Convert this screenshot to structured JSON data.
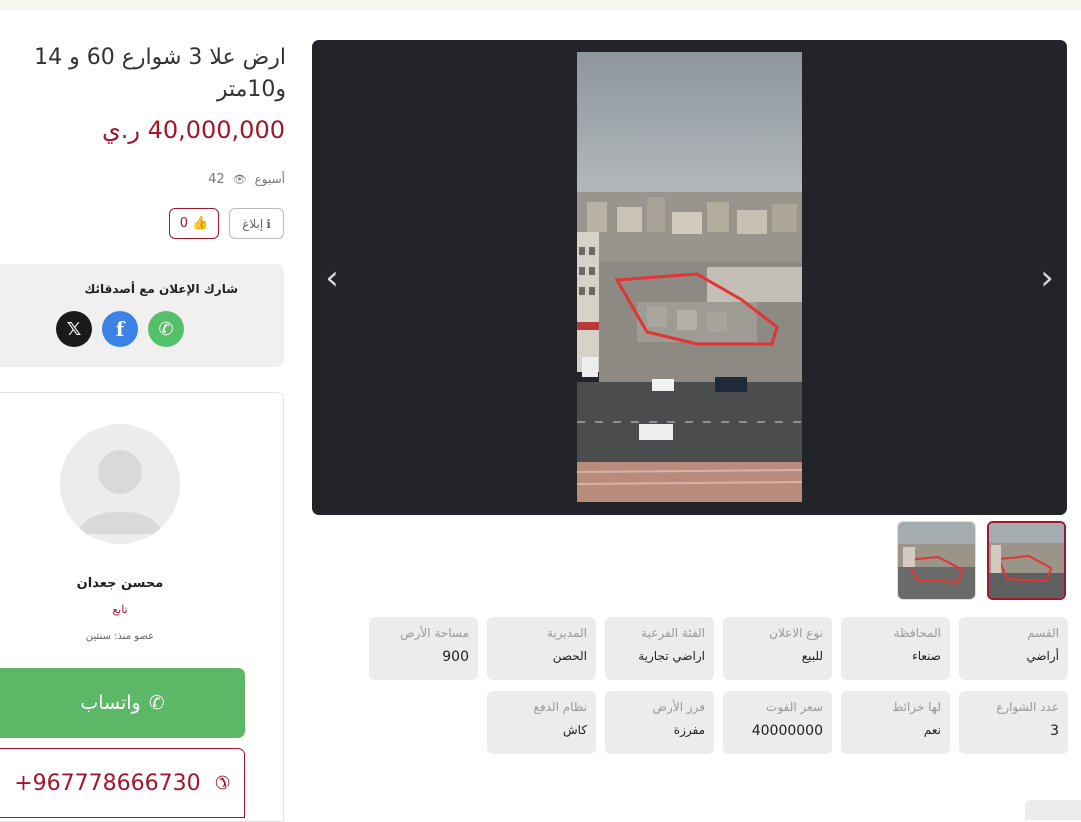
{
  "listing": {
    "title": "ارض علا 3 شوارع 60 و 14 و10متر",
    "price": "40,000,000 ر.ي",
    "views": "42",
    "posted": "أسبوع",
    "report_label": "إبلاغ",
    "likes": "0"
  },
  "share": {
    "title": "شارك الإعلان مع أصدقائك",
    "x_icon": "x-icon",
    "facebook_icon": "facebook-icon",
    "whatsapp_icon": "whatsapp-icon"
  },
  "seller": {
    "name": "محسن جعدان",
    "type": "تابع",
    "member_since": "عضو منذ: سنتين"
  },
  "contact": {
    "whatsapp_label": "واتساب",
    "phone": "+967778666730"
  },
  "gallery": {
    "prev_icon": "chevron-left-icon",
    "next_icon": "chevron-right-icon"
  },
  "attributes_row1": [
    {
      "key": "القسم",
      "value": "أراضي"
    },
    {
      "key": "المحافظة",
      "value": "صنعاء"
    },
    {
      "key": "نوع الاعلان",
      "value": "للبيع"
    },
    {
      "key": "الفئة الفرعية",
      "value": "اراضي تجارية"
    },
    {
      "key": "المديرية",
      "value": "الحصن"
    },
    {
      "key": "مساحة الأرض",
      "value": "900"
    }
  ],
  "attributes_row2": [
    {
      "key": "عدد الشوارع",
      "value": "3"
    },
    {
      "key": "لها خرائط",
      "value": "نعم"
    },
    {
      "key": "سعر الفوت",
      "value": "40000000"
    },
    {
      "key": "فرز الأرض",
      "value": "مفرزة"
    },
    {
      "key": "نظام الدفع",
      "value": "كاش"
    }
  ],
  "colors": {
    "accent": "#a0172b",
    "whatsapp": "#5cb867",
    "facebook": "#3b82e6"
  }
}
